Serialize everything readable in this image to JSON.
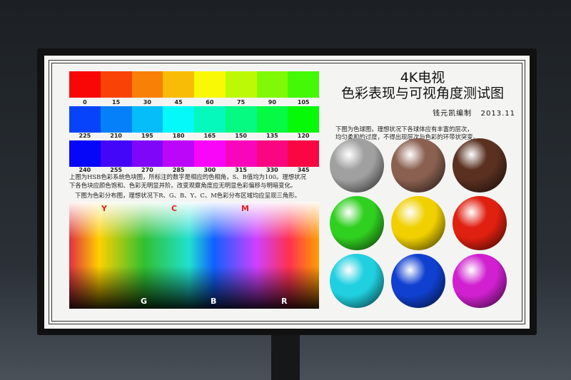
{
  "row1": {
    "hues": [
      0,
      15,
      30,
      45,
      60,
      75,
      90,
      105
    ],
    "labels": [
      "0",
      "15",
      "30",
      "45",
      "60",
      "75",
      "90",
      "105"
    ]
  },
  "row2": {
    "hues": [
      225,
      210,
      195,
      180,
      165,
      150,
      135,
      120
    ],
    "labels": [
      "225",
      "210",
      "195",
      "180",
      "165",
      "150",
      "135",
      "120"
    ]
  },
  "row3": {
    "hues": [
      240,
      255,
      270,
      285,
      300,
      315,
      330,
      345
    ],
    "labels": [
      "240",
      "255",
      "270",
      "285",
      "300",
      "315",
      "330",
      "345"
    ]
  },
  "text": {
    "line1": "上图为HSB色彩系统色块图，所标注的数字是相应的色相角，S、B值均为100。理想状况",
    "line2": "下各色块应颜色饱和、色彩无明显并阶。改变观察角度应无明显色彩偏移与明暗变化。",
    "line3": "下图为色彩分布图，理想状况下R、G、B、Y、C、M色彩分布区域均应呈现三角形。"
  },
  "gradient": {
    "top": [
      "Y",
      "C",
      "M"
    ],
    "bottom": [
      "G",
      "B",
      "R"
    ]
  },
  "title": {
    "line1": "4K电视",
    "line2": "色彩表现与可视角度测试图",
    "author": "钱元凯编制",
    "date": "2013.11"
  },
  "spheres_text": {
    "line1": "下图为色球图，理想状况下各球体应有丰富的层次，",
    "line2": "均匀柔和的过度，不得出现层次与色彩的环带状突变。"
  },
  "spheres": [
    "#a0a0a0",
    "#8a6050",
    "#5a3020",
    "#30d020",
    "#f0d000",
    "#e02010",
    "#20d0e0",
    "#1040d0",
    "#d020d0"
  ]
}
